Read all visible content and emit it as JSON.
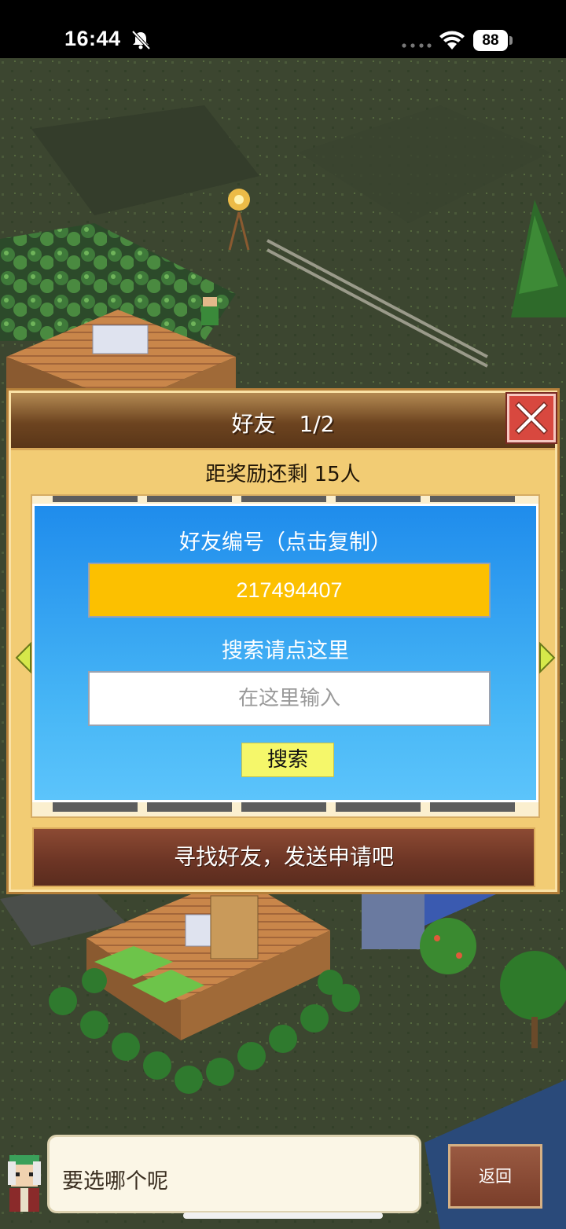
{
  "status_bar": {
    "time": "16:44",
    "battery": "88",
    "icons": [
      "bell-slash-icon",
      "dots-icon",
      "wifi-icon",
      "battery-icon"
    ]
  },
  "dialog": {
    "title": "好友",
    "page": "1/2",
    "reward_text": "距奖励还剩 15人",
    "friend_id_label": "好友编号（点击复制）",
    "friend_id": "217494407",
    "search_label": "搜索请点这里",
    "search_placeholder": "在这里输入",
    "search_button": "搜索",
    "find_button": "寻找好友，发送申请吧",
    "close_icon": "close-icon",
    "nav_icons": [
      "arrow-left-icon",
      "arrow-right-icon"
    ]
  },
  "bottom": {
    "speech": "要选哪个呢",
    "back_button": "返回"
  },
  "colors": {
    "dialog_bg": "#f2cc74",
    "header": "#6d4420",
    "panel": "#1f8cec",
    "id_field": "#fcc000",
    "search_button": "#f5f76a",
    "close_button": "#d8483f",
    "find_button": "#6b3424"
  }
}
